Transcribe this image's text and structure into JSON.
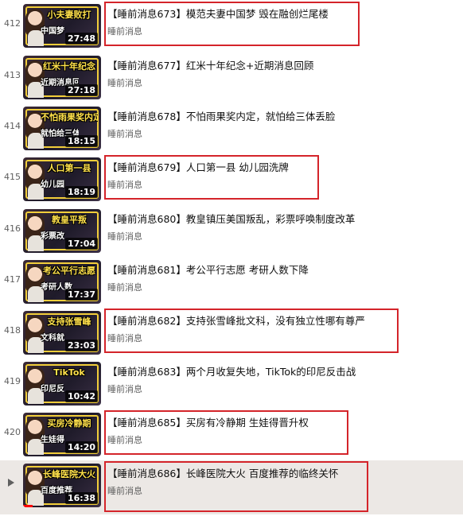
{
  "playlist": {
    "items": [
      {
        "index": "412",
        "caption": "小夫妻败打",
        "caption2": "中国梦",
        "duration": "27:48",
        "title": "【睡前消息673】模范夫妻中国梦 毁在融创烂尾楼",
        "channel": "睡前消息",
        "highlighted": true
      },
      {
        "index": "413",
        "caption": "红米十年纪念",
        "caption2": "近期消息回",
        "duration": "27:18",
        "title": "【睡前消息677】红米十年纪念+近期消息回顾",
        "channel": "睡前消息",
        "highlighted": false
      },
      {
        "index": "414",
        "caption": "不怕雨果奖内定",
        "caption2": "就怕给三体",
        "duration": "18:15",
        "title": "【睡前消息678】不怕雨果奖内定，就怕给三体丢脸",
        "channel": "睡前消息",
        "highlighted": false
      },
      {
        "index": "415",
        "caption": "人口第一县",
        "caption2": "幼儿园",
        "duration": "18:19",
        "title": "【睡前消息679】人口第一县 幼儿园洗牌",
        "channel": "睡前消息",
        "highlighted": true
      },
      {
        "index": "416",
        "caption": "教皇平叛",
        "caption2": "彩票改",
        "duration": "17:04",
        "title": "【睡前消息680】教皇镇压美国叛乱，彩票呼唤制度改革",
        "channel": "睡前消息",
        "highlighted": false
      },
      {
        "index": "417",
        "caption": "考公平行志愿",
        "caption2": "考研人数",
        "duration": "17:37",
        "title": "【睡前消息681】考公平行志愿 考研人数下降",
        "channel": "睡前消息",
        "highlighted": false
      },
      {
        "index": "418",
        "caption": "支持张雪峰",
        "caption2": "文科就",
        "duration": "23:03",
        "title": "【睡前消息682】支持张雪峰批文科，没有独立性哪有尊严",
        "channel": "睡前消息",
        "highlighted": true
      },
      {
        "index": "419",
        "caption": "TikTok",
        "caption2": "印尼反",
        "duration": "10:42",
        "title": "【睡前消息683】两个月收复失地，TikTok的印尼反击战",
        "channel": "睡前消息",
        "highlighted": false
      },
      {
        "index": "420",
        "caption": "买房冷静期",
        "caption2": "生娃得",
        "duration": "14:20",
        "title": "【睡前消息685】买房有冷静期 生娃得晋升权",
        "channel": "睡前消息",
        "highlighted": true
      },
      {
        "index": "",
        "caption": "长峰医院大火",
        "caption2": "百度推荐",
        "duration": "16:38",
        "title": "【睡前消息686】长峰医院大火 百度推荐的临终关怀",
        "channel": "睡前消息",
        "highlighted": true,
        "active": true
      }
    ]
  },
  "colors": {
    "highlight_box": "#d4242a",
    "active_bg": "#ece8e5",
    "caption_yellow": "#ffe14a"
  },
  "icons": {
    "now_playing": "play-triangle-icon"
  }
}
